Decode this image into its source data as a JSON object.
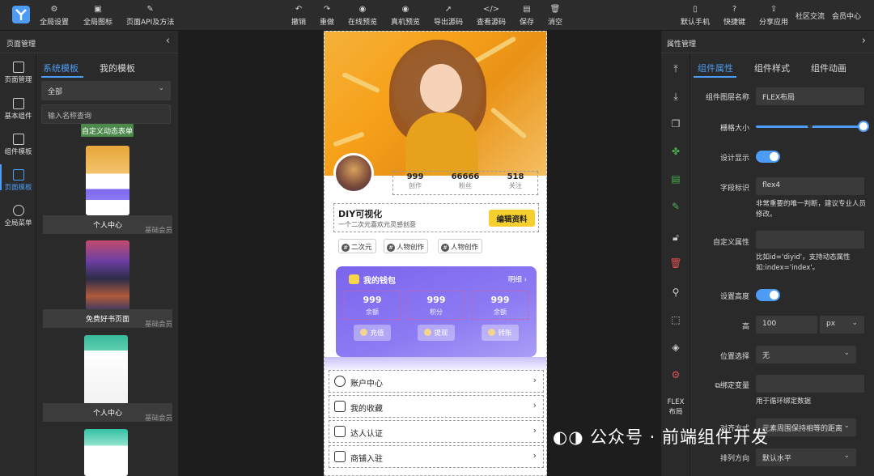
{
  "toolbar": {
    "left": [
      {
        "label": "全局设置",
        "icon": "settings-icon"
      },
      {
        "label": "全局图标",
        "icon": "image-icon"
      },
      {
        "label": "页面API及方法",
        "icon": "api-icon"
      }
    ],
    "center": [
      {
        "label": "撤销",
        "icon": "undo-icon"
      },
      {
        "label": "重做",
        "icon": "redo-icon"
      },
      {
        "label": "在线预览",
        "icon": "eye-icon"
      },
      {
        "label": "真机预览",
        "icon": "eye-icon"
      },
      {
        "label": "导出源码",
        "icon": "export-icon"
      },
      {
        "label": "查看源码",
        "icon": "code-icon"
      },
      {
        "label": "保存",
        "icon": "save-icon"
      },
      {
        "label": "消空",
        "icon": "trash-icon"
      }
    ],
    "right": [
      {
        "label": "默认手机",
        "icon": "phone-icon"
      },
      {
        "label": "快捷键",
        "icon": "help-icon"
      },
      {
        "label": "分享应用",
        "icon": "share-icon"
      },
      {
        "label": "社区交流"
      },
      {
        "label": "会员中心"
      }
    ]
  },
  "left_panel": {
    "title": "页面管理",
    "collapse": "‹",
    "rail": [
      {
        "label": "页面管理"
      },
      {
        "label": "基本组件"
      },
      {
        "label": "组件模板"
      },
      {
        "label": "页面模板"
      },
      {
        "label": "全局菜单"
      }
    ],
    "tabs": [
      "系统模板",
      "我的模板"
    ],
    "filter_value": "全部",
    "search_placeholder": "输入名称查询",
    "chip": "自定义动态表单",
    "templates": [
      {
        "name": "个人中心",
        "tag": "基础会员"
      },
      {
        "name": "免费好书页面",
        "tag": "基础会员"
      },
      {
        "name": "个人中心",
        "tag": "基础会员"
      }
    ]
  },
  "phone": {
    "stats": [
      {
        "value": "999",
        "label": "创作"
      },
      {
        "value": "66666",
        "label": "粉丝"
      },
      {
        "value": "518",
        "label": "关注"
      }
    ],
    "name": "DIY可视化",
    "bio": "一个二次元喜欢元灵感创意",
    "edit_button": "编辑资料",
    "tags": [
      "二次元",
      "人物创作",
      "人物创作"
    ],
    "wallet": {
      "title": "我的钱包",
      "detail": "明细 ›",
      "cells": [
        {
          "value": "999",
          "label": "余额"
        },
        {
          "value": "999",
          "label": "积分"
        },
        {
          "value": "999",
          "label": "余额"
        }
      ],
      "buttons": [
        "充值",
        "提现",
        "转账"
      ]
    },
    "menu": [
      "账户中心",
      "我的收藏",
      "达人认证",
      "商铺入驻"
    ]
  },
  "right_panel": {
    "title": "属性管理",
    "expand": "›",
    "rail_bottom": "FLEX\n布局",
    "tabs": [
      "组件属性",
      "组件样式",
      "组件动画"
    ],
    "fields": {
      "layer_name_label": "组件图层名称",
      "layer_name_value": "FLEX布局",
      "grid_label": "栅格大小",
      "grid_level": 1.0,
      "design_show_label": "设计显示",
      "field_id_label": "字段标识",
      "field_id_value": "flex4",
      "field_id_hint": "非常重要的唯一判断，建议专业人员修改。",
      "custom_attr_label": "自定义属性",
      "custom_attr_hint": "比如id='diyid'，支持动态属性如:index='index'。",
      "set_height_label": "设置高度",
      "height_label": "高",
      "height_value": "100",
      "height_unit": "px",
      "position_label": "位置选择",
      "position_value": "无",
      "bind_var_label": "绑定变量",
      "bind_var_hint": "用于循环绑定数据",
      "align_label": "对齐方式",
      "align_value": "元素周围保持相等的距离",
      "direction_label": "排列方向",
      "direction_value": "默认水平"
    }
  },
  "watermark": "公众号 · 前端组件开发",
  "colors": {
    "accent": "#4c9cf5",
    "wallet": "#7b64ee",
    "edit_button": "#f6cf2e"
  }
}
